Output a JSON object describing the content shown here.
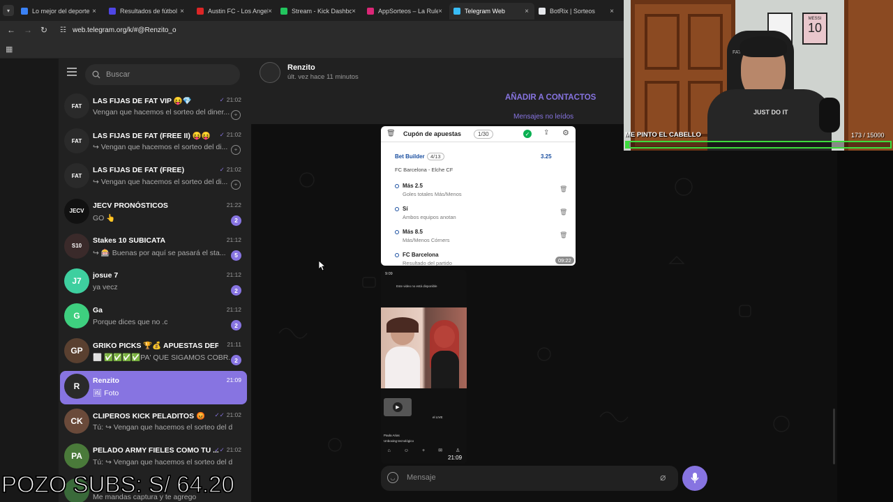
{
  "browser": {
    "tabs": [
      {
        "label": "Lo mejor del deporte",
        "color": "#3b82f6"
      },
      {
        "label": "Resultados de fútbol",
        "color": "#4f46e5"
      },
      {
        "label": "Austin FC - Los Angeles",
        "color": "#dc2626"
      },
      {
        "label": "Stream - Kick Dashboard",
        "color": "#22c55e"
      },
      {
        "label": "AppSorteos – La Ruleta",
        "color": "#db2777"
      },
      {
        "label": "Telegram Web",
        "color": "#38bdf8"
      },
      {
        "label": "BotRix | Sorteos",
        "color": "#e5e7eb"
      }
    ],
    "close_glyph": "×",
    "url": "web.telegram.org/k/#@Renzito_o"
  },
  "sidebar": {
    "search_placeholder": "Buscar",
    "chats": [
      {
        "name": "LAS FIJAS DE FAT VIP 😝💎",
        "preview": "Vengan que hacemos el sorteo del diner...",
        "time": "21:02",
        "status": "✓",
        "pinned": true,
        "avatar": "FAT",
        "avatar_color": "#2a2a2a"
      },
      {
        "name": "LAS FIJAS DE FAT (FREE II) 😝😝",
        "preview": "↪ Vengan que hacemos el sorteo del di...",
        "time": "21:02",
        "status": "✓",
        "pinned": true,
        "avatar": "FAT",
        "avatar_color": "#2a2a2a"
      },
      {
        "name": "LAS FIJAS DE FAT (FREE)",
        "preview": "↪ Vengan que hacemos el sorteo del di...",
        "time": "21:02",
        "status": "✓",
        "pinned": true,
        "avatar": "FAT",
        "avatar_color": "#2a2a2a"
      },
      {
        "name": "JECV PRONÓSTICOS",
        "preview": "GO 👆",
        "time": "21:22",
        "badge": "2",
        "avatar": "JECV",
        "avatar_color": "#111111"
      },
      {
        "name": "Stakes 10 SUBICATA",
        "preview": "↪ 🎰 Buenas por aquí se pasará el sta...",
        "time": "21:12",
        "badge": "5",
        "avatar": "S10",
        "avatar_color": "#3a2a2a"
      },
      {
        "name": "josue 7",
        "preview": "ya vecz",
        "time": "21:12",
        "badge": "2",
        "avatar": "J7",
        "avatar_color": "#3ecf9f"
      },
      {
        "name": "Ga",
        "preview": "Porque dices que no .c",
        "time": "21:12",
        "badge": "2",
        "avatar": "G",
        "avatar_color": "#3ecf7f"
      },
      {
        "name": "GRIKO PICKS 🏆💰 APUESTAS DEPO...",
        "preview": "⬜ ✅✅✅✅PA' QUE SIGAMOS COBR...",
        "time": "21:11",
        "badge": "2",
        "avatar": "GP",
        "avatar_color": "#5a4030"
      },
      {
        "name": "Renzito",
        "preview": "🖼 Foto",
        "time": "21:09",
        "active": true,
        "avatar": "R",
        "avatar_color": "#2a2a2a"
      },
      {
        "name": "CLIPEROS KICK PELADITOS 😡",
        "preview": "Tú: ↪ Vengan que hacemos el sorteo del di...",
        "time": "21:02",
        "status": "✓✓",
        "avatar": "CK",
        "avatar_color": "#6a4a3a"
      },
      {
        "name": "PELADO ARMY FIELES COMO TU ...",
        "preview": "Tú: ↪ Vengan que hacemos el sorteo del di...",
        "time": "21:02",
        "status": "✓✓",
        "avatar": "PA",
        "avatar_color": "#4a7a3a"
      },
      {
        "name": "",
        "preview": "Me mandas captura y te agrego",
        "time": "",
        "avatar": "",
        "avatar_color": "#3a6a3a"
      }
    ]
  },
  "chat": {
    "title": "Renzito",
    "subtitle": "últ. vez hace 11 minutos",
    "add_contact": "AÑADIR A CONTACTOS",
    "unread_label": "Mensajes no leídos",
    "coupon": {
      "title": "Cupón de apuestas",
      "count": "1/30",
      "bet_builder": "Bet Builder",
      "bet_count": "4/13",
      "odds": "3.25",
      "match": "FC Barcelona - Elche CF",
      "selections": [
        {
          "pick": "Más 2.5",
          "market": "Goles totales Más/Menos"
        },
        {
          "pick": "Sí",
          "market": "Ambos equipos anotan"
        },
        {
          "pick": "Más 8.5",
          "market": "Más/Menos Córners"
        },
        {
          "pick": "FC Barcelona",
          "market": "Resultado del partido"
        }
      ],
      "time": "09:22"
    },
    "photo": {
      "phone_time": "9:09",
      "header_text": "Este video no está disponible",
      "live_label": "el LIVE",
      "user": "Paula Arias",
      "tag": "Unboxing tecnológico",
      "time": "21:09"
    },
    "composer_placeholder": "Mensaje"
  },
  "stream": {
    "cam_text": "ME PINTO EL CABELLO",
    "cam_progress": "173 / 15000",
    "cam_progress_fraction": 0.0115,
    "overlay": "POZO SUBS: S/ 64.20",
    "shirt_text": "JUST DO IT",
    "frame_name": "MESSI",
    "frame_number": "10",
    "chair_brand": "FATTO"
  },
  "colors": {
    "accent": "#8774e1",
    "check_green": "#0ab052",
    "progress_green": "#3ddc3d"
  }
}
